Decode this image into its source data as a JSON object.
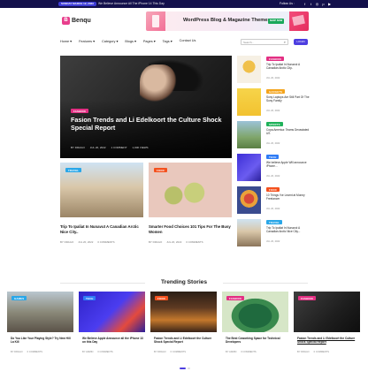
{
  "topbar": {
    "date": "SUNDAY MARCH 12, 2023",
    "ticker": "We Believe Announce All The iPhone 14 This Day",
    "follow": "Follow Us :",
    "social_icons": [
      "facebook-icon",
      "twitter-icon",
      "instagram-icon",
      "pinterest-icon",
      "youtube-icon"
    ],
    "social_glyphs": [
      "f",
      "t",
      "◎",
      "p",
      "▶"
    ]
  },
  "logo": {
    "mark": "B",
    "name": "Benqu"
  },
  "banner": {
    "text": "WordPress Blog & Magazine Themes",
    "button": "SHOP NOW"
  },
  "nav": {
    "items": [
      "Home ▾",
      "Features ▾",
      "Category ▾",
      "Blogs ▾",
      "Pages ▾",
      "Tags ▾",
      "Contact Us"
    ]
  },
  "search": {
    "placeholder": "Search...",
    "icon": "⌕"
  },
  "login": {
    "label": "LOGIN"
  },
  "hero": {
    "badge": "FASHION",
    "title": "Fasion Trends and Li Edelkoort the Culture Shock Special Report",
    "author": "BY DRAGO",
    "date": "JUL 20, 2022",
    "comments": "1 COMMENT",
    "views": "1,000 VIEWS"
  },
  "cards": [
    {
      "badge": "TRAVEL",
      "title": "Trip To Ipaliat In Nunavut A Canadian Arctic Nice City..",
      "author": "BY DRAGO",
      "date": "JUL 20, 2022",
      "comments": "0 COMMENTS"
    },
    {
      "badge": "FOOD",
      "title": "Smarter Food Choices 101 Tips For The Busy Women",
      "author": "BY DRAGO",
      "date": "JUL 20, 2022",
      "comments": "0 COMMENTS"
    }
  ],
  "sidebar": [
    {
      "badge": "FASHION",
      "title": "Trip To Ipaliat In Nunavut A Canadian Arctic City..",
      "date": "JUL 20, 2022"
    },
    {
      "badge": "GADGETS",
      "title": "Sony Laptops Are Still Part Of The Sony Family",
      "date": "JUL 20, 2022"
    },
    {
      "badge": "SPORTS",
      "title": "Copa America: Teams Devastated US",
      "date": "JUL 20, 2022"
    },
    {
      "badge": "TECH",
      "title": "We believe Apple Will announce iPhone...",
      "date": "JUL 20, 2022"
    },
    {
      "badge": "FOOD",
      "title": "10 Things I've Learnt at Money Freelancer",
      "date": "JUL 20, 2022"
    },
    {
      "badge": "TRAVEL",
      "title": "Trip To Ipaliat In Nunavut A Canadian Arctic Nice City...",
      "date": "JUL 20, 2022"
    }
  ],
  "trending": {
    "heading": "Trending Stories",
    "items": [
      {
        "badge": "GAMES",
        "title": "Do You Like Your Playing Style? Try New Hill La Kill",
        "author": "BY DRAGO",
        "comments": "0 COMMENTS"
      },
      {
        "badge": "TECH",
        "title": "We Believe Apple Announce all the iPhone 13 on this Day",
        "author": "BY ADMIN",
        "comments": "0 COMMENTS"
      },
      {
        "badge": "FOOD",
        "title": "Fasion Trends and Li Edelkoort the Culture Shock Special Report",
        "author": "BY DRAGO",
        "comments": "0 COMMENTS"
      },
      {
        "badge": "FASHION",
        "title": "The Best Coworking Space for Technical Developers",
        "author": "BY ADMIN",
        "comments": "0 COMMENTS"
      },
      {
        "badge": "FASHION",
        "title": "Fasion Trends and Li Edelkoort the Culture Shock Special Report",
        "author": "BY DRAGO",
        "comments": "0 COMMENTS"
      }
    ]
  },
  "colors": {
    "accent": "#4d3ee0",
    "fashion": "#e32f83",
    "gadgets": "#f4a41c",
    "sports": "#1fb25a",
    "tech": "#2f7cf6",
    "food": "#f4511e",
    "travel": "#2aa7e8",
    "games": "#2aa7e8",
    "dark": "#13104b"
  }
}
